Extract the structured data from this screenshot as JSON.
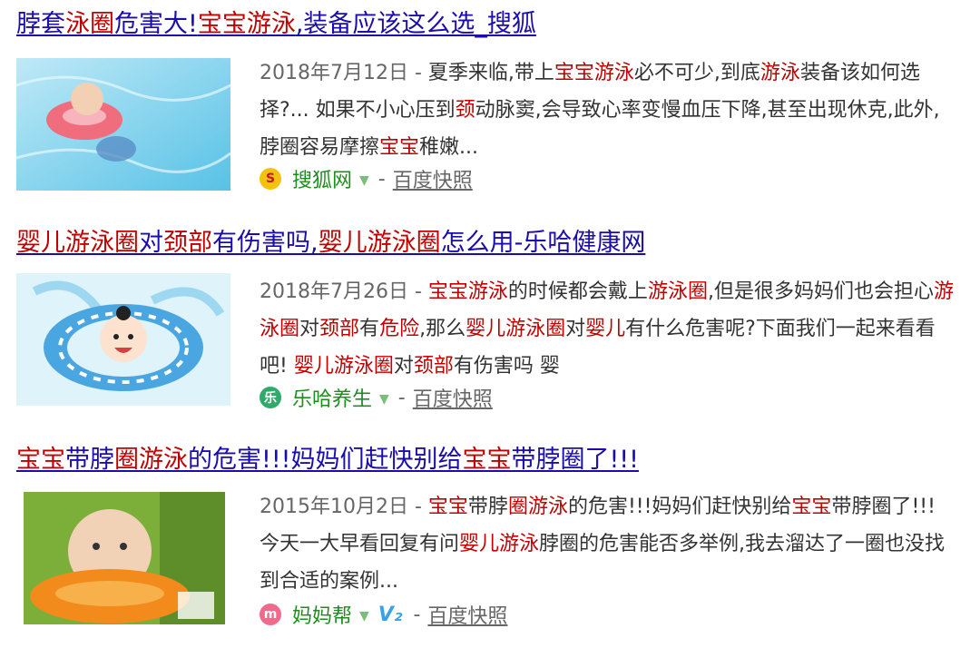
{
  "results": [
    {
      "title": [
        {
          "t": "脖套",
          "hl": false
        },
        {
          "t": "泳圈",
          "hl": true
        },
        {
          "t": "危害大!",
          "hl": false
        },
        {
          "t": "宝宝游泳",
          "hl": true
        },
        {
          "t": ",装备应该这么选_搜狐",
          "hl": false
        }
      ],
      "date": "2018年7月12日 - ",
      "snippet": [
        {
          "t": "夏季来临,带上",
          "hl": false
        },
        {
          "t": "宝宝游泳",
          "hl": true
        },
        {
          "t": "必不可少,到底",
          "hl": false
        },
        {
          "t": "游泳",
          "hl": true
        },
        {
          "t": "装备该如何选择?... 如果不小心压到",
          "hl": false
        },
        {
          "t": "颈",
          "hl": true
        },
        {
          "t": "动脉窦,会导致心率变慢血压下降,甚至出现休克,此外,脖圈容易摩擦",
          "hl": false
        },
        {
          "t": "宝宝",
          "hl": true
        },
        {
          "t": "稚嫩...",
          "hl": false
        }
      ],
      "site": "搜狐网",
      "separator": "-",
      "cache": "百度快照"
    },
    {
      "title": [
        {
          "t": "婴儿游泳圈",
          "hl": true
        },
        {
          "t": "对",
          "hl": false
        },
        {
          "t": "颈部",
          "hl": true
        },
        {
          "t": "有伤害吗,",
          "hl": false
        },
        {
          "t": "婴儿游泳圈",
          "hl": true
        },
        {
          "t": "怎么用-乐哈健康网",
          "hl": false
        }
      ],
      "date": "2018年7月26日 - ",
      "snippet": [
        {
          "t": "宝宝游泳",
          "hl": true
        },
        {
          "t": "的时候都会戴上",
          "hl": false
        },
        {
          "t": "游泳圈",
          "hl": true
        },
        {
          "t": ",但是很多妈妈们也会担心",
          "hl": false
        },
        {
          "t": "游泳圈",
          "hl": true
        },
        {
          "t": "对",
          "hl": false
        },
        {
          "t": "颈部",
          "hl": true
        },
        {
          "t": "有",
          "hl": false
        },
        {
          "t": "危险",
          "hl": true
        },
        {
          "t": ",那么",
          "hl": false
        },
        {
          "t": "婴儿游泳圈",
          "hl": true
        },
        {
          "t": "对",
          "hl": false
        },
        {
          "t": "婴儿",
          "hl": true
        },
        {
          "t": "有什么危害呢?下面我们一起来看看吧! ",
          "hl": false
        },
        {
          "t": "婴儿游泳圈",
          "hl": true
        },
        {
          "t": "对",
          "hl": false
        },
        {
          "t": "颈部",
          "hl": true
        },
        {
          "t": "有伤害吗 婴",
          "hl": false
        }
      ],
      "site": "乐哈养生",
      "separator": "-",
      "cache": "百度快照"
    },
    {
      "title": [
        {
          "t": "宝宝",
          "hl": true
        },
        {
          "t": "带脖",
          "hl": false
        },
        {
          "t": "圈游泳",
          "hl": true
        },
        {
          "t": "的危害!!!妈妈们赶快别给",
          "hl": false
        },
        {
          "t": "宝宝",
          "hl": true
        },
        {
          "t": "带脖圈了!!!",
          "hl": false
        }
      ],
      "date": "2015年10月2日 - ",
      "snippet": [
        {
          "t": "宝宝",
          "hl": true
        },
        {
          "t": "带脖",
          "hl": false
        },
        {
          "t": "圈游泳",
          "hl": true
        },
        {
          "t": "的危害!!!妈妈们赶快别给",
          "hl": false
        },
        {
          "t": "宝宝",
          "hl": true
        },
        {
          "t": "带脖圈了!!! 今天一大早看回复有问",
          "hl": false
        },
        {
          "t": "婴儿游泳",
          "hl": true
        },
        {
          "t": "脖圈的危害能否多举例,我去溜达了一圈也没找到合适的案例...",
          "hl": false
        }
      ],
      "site": "妈妈帮",
      "badge": "V₂",
      "separator": "-",
      "cache": "百度快照"
    }
  ],
  "colors": {
    "link": "#1a0dab",
    "highlight": "#c00000",
    "site": "#1e8c1e"
  },
  "icons": {
    "result1": "sohu-logo-icon",
    "result2": "leha-logo-icon",
    "result3": "mamabang-logo-icon"
  }
}
